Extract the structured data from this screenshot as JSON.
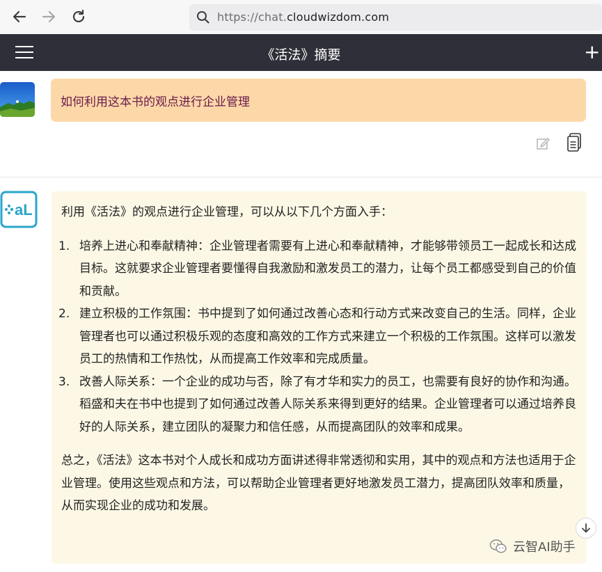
{
  "browser": {
    "url_prefix": "https://chat.",
    "url_domain": "cloudwizdom.com"
  },
  "header": {
    "title": "《活法》摘要",
    "new_label": "+"
  },
  "user_message": {
    "text": "如何利用这本书的观点进行企业管理"
  },
  "ai_message": {
    "intro": "利用《活法》的观点进行企业管理，可以从以下几个方面入手：",
    "points": [
      {
        "num": "1.",
        "text": "培养上进心和奉献精神：企业管理者需要有上进心和奉献精神，才能够带领员工一起成长和达成目标。这就要求企业管理者要懂得自我激励和激发员工的潜力，让每个员工都感受到自己的价值和贡献。"
      },
      {
        "num": "2.",
        "text": "建立积极的工作氛围：书中提到了如何通过改善心态和行动方式来改变自己的生活。同样，企业管理者也可以通过积极乐观的态度和高效的工作方式来建立一个积极的工作氛围。这样可以激发员工的热情和工作热忱，从而提高工作效率和完成质量。"
      },
      {
        "num": "3.",
        "text": "改善人际关系：一个企业的成功与否，除了有才华和实力的员工，也需要有良好的协作和沟通。稻盛和夫在书中也提到了如何通过改善人际关系来得到更好的结果。企业管理者可以通过培养良好的人际关系，建立团队的凝聚力和信任感，从而提高团队的效率和成果。"
      }
    ],
    "summary": "总之，《活法》这本书对个人成长和成功方面讲述得非常透彻和实用，其中的观点和方法也适用于企业管理。使用这些观点和方法，可以帮助企业管理者更好地激发员工潜力，提高团队效率和质量，从而实现企业的成功和发展。"
  },
  "watermark": {
    "text": "云智AI助手"
  },
  "colors": {
    "header_bg": "#2e2f38",
    "user_bubble": "#fcd8a8",
    "user_text": "#6a1a4a",
    "ai_bubble": "#fdf8e6",
    "ai_logo": "#2aa5c9"
  }
}
